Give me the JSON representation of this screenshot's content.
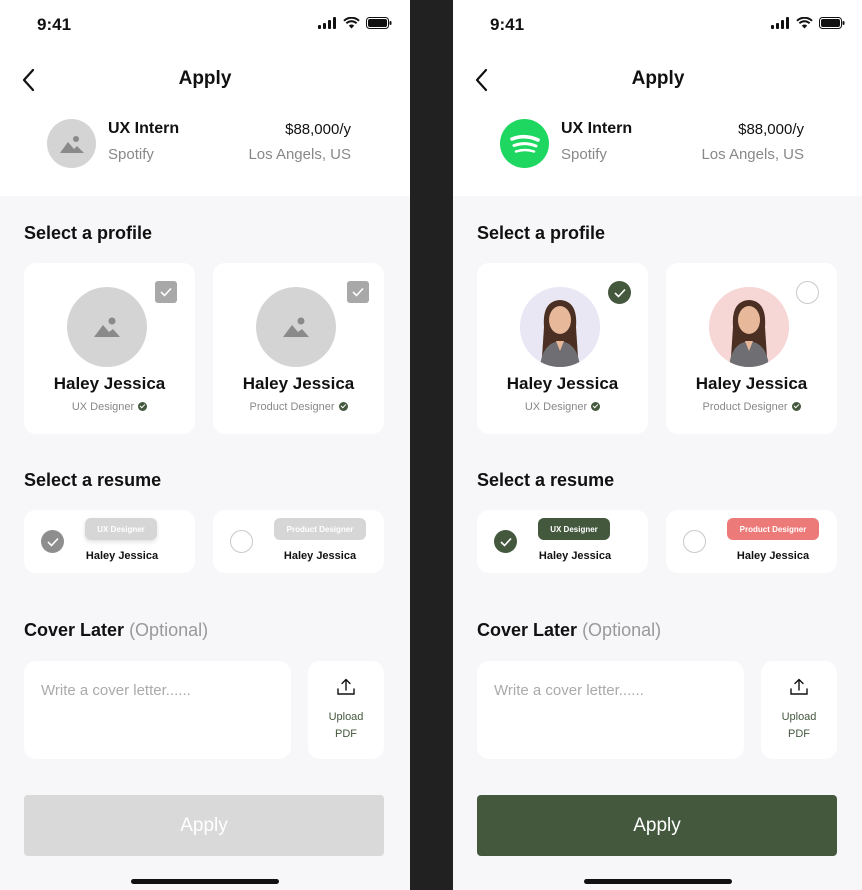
{
  "status_time": "9:41",
  "page_title": "Apply",
  "job": {
    "title": "UX Intern",
    "company": "Spotify",
    "salary": "$88,000/y",
    "location": "Los Angels, US"
  },
  "sections": {
    "profile": "Select a profile",
    "resume": "Select a resume",
    "cover": "Cover Later",
    "cover_optional": "(Optional)"
  },
  "profiles": [
    {
      "name": "Haley Jessica",
      "role": "UX Designer"
    },
    {
      "name": "Haley Jessica",
      "role": "Product Designer"
    }
  ],
  "resumes": [
    {
      "tag": "UX Designer",
      "name": "Haley Jessica"
    },
    {
      "tag": "Product Designer",
      "name": "Haley Jessica"
    }
  ],
  "cover_placeholder": "Write a cover letter......",
  "upload_label_1": "Upload",
  "upload_label_2": "PDF",
  "apply_label": "Apply",
  "colors": {
    "accent": "#44583e",
    "spotify": "#1ed760",
    "resume_tag_red": "#ec7a78",
    "disabled": "#d9d9d9"
  },
  "screens": [
    {
      "state": "empty",
      "profile_selected": "none",
      "resume_selected": "ux",
      "apply_enabled": false
    },
    {
      "state": "filled",
      "profile_selected": "ux",
      "resume_selected": "ux",
      "apply_enabled": true
    }
  ]
}
